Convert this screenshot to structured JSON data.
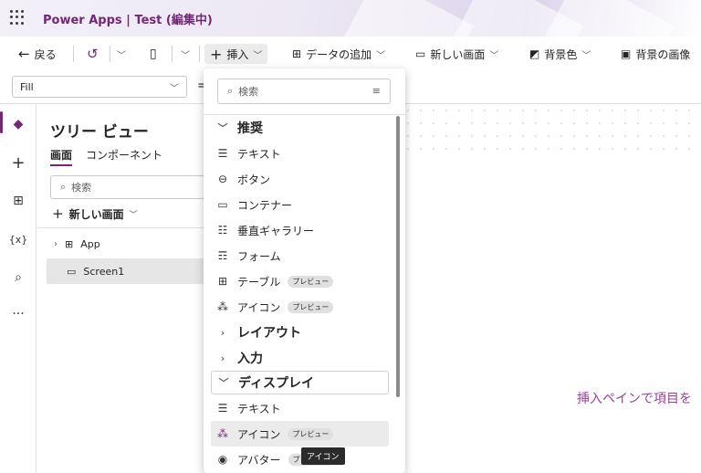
{
  "titlebar": {
    "app": "Power Apps",
    "separator": "|",
    "doc": "Test (編集中)"
  },
  "commandbar": {
    "back": "戻る",
    "insert": "挿入",
    "add_data": "データの追加",
    "new_screen": "新しい画面",
    "background_color": "背景色",
    "background_image": "背景の画像"
  },
  "formula": {
    "property": "Fill",
    "equals": "="
  },
  "treeview": {
    "title": "ツリー ビュー",
    "tab_screens": "画面",
    "tab_components": "コンポーネント",
    "search_placeholder": "検索",
    "new_screen": "新しい画面",
    "items": [
      {
        "label": "App",
        "icon": "app-icon"
      },
      {
        "label": "Screen1",
        "icon": "screen-icon"
      }
    ]
  },
  "insert_pane": {
    "search_placeholder": "検索",
    "items": [
      {
        "label": "推奨",
        "type": "group",
        "icon": "chevron-down"
      },
      {
        "label": "テキスト",
        "icon": "text-icon"
      },
      {
        "label": "ボタン",
        "icon": "button-icon"
      },
      {
        "label": "コンテナー",
        "icon": "container-icon"
      },
      {
        "label": "垂直ギャラリー",
        "icon": "gallery-icon"
      },
      {
        "label": "フォーム",
        "icon": "form-icon"
      },
      {
        "label": "テーブル",
        "icon": "table-icon",
        "badge": "プレビュー"
      },
      {
        "label": "アイコン",
        "icon": "icons-icon",
        "badge": "プレビュー"
      },
      {
        "label": "レイアウト",
        "type": "group",
        "icon": "chevron-right"
      },
      {
        "label": "入力",
        "type": "group",
        "icon": "chevron-right"
      },
      {
        "label": "ディスプレイ",
        "type": "group",
        "icon": "chevron-down"
      },
      {
        "label": "テキスト",
        "icon": "text-icon"
      },
      {
        "label": "アイコン",
        "icon": "icons-icon",
        "badge": "プレビュー"
      },
      {
        "label": "アバター",
        "icon": "avatar-icon",
        "badge": "プレビュー"
      }
    ],
    "tooltip": "アイコン"
  },
  "canvas": {
    "hint": "挿入ペインで項目を"
  },
  "colors": {
    "accent": "#742774"
  }
}
